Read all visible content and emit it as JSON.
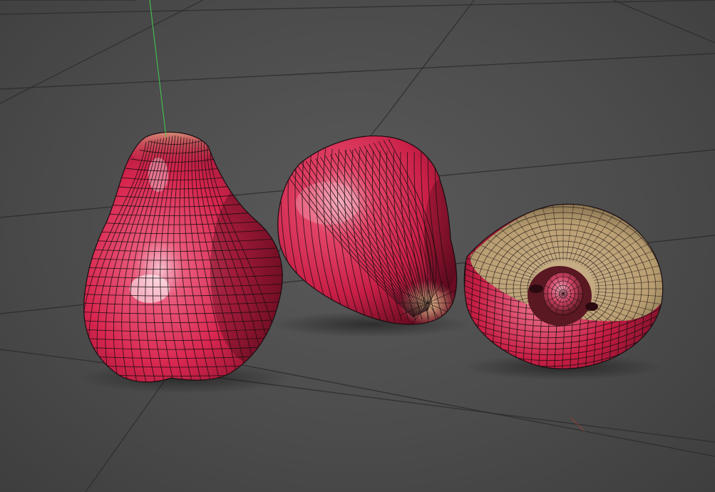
{
  "viewport": {
    "kind": "3d-perspective-viewport",
    "display_mode": "textured-wireframe",
    "background_color": "#4b4b4b",
    "grid_line_color": "#2e2e2e",
    "axis_y_color": "#3fd04a",
    "axis_x_color": "#c0392b",
    "wire_color": "#1a0d10"
  },
  "scene": {
    "objects": [
      {
        "name": "rose-apple-upright",
        "base_color": "#d8264f",
        "highlight_color": "#f7c2cf",
        "top_color": "#d9b98a",
        "shading": "red-skin"
      },
      {
        "name": "rose-apple-lying",
        "base_color": "#d8264f",
        "highlight_color": "#f2a9b8",
        "top_color": "#e3c38f",
        "shading": "red-skin"
      },
      {
        "name": "rose-apple-halved",
        "base_color": "#c81e45",
        "cut_face_color": "#b99f72",
        "seed_cavity_color": "#5a1822",
        "shading": "red-skin-with-cut-face"
      }
    ]
  }
}
